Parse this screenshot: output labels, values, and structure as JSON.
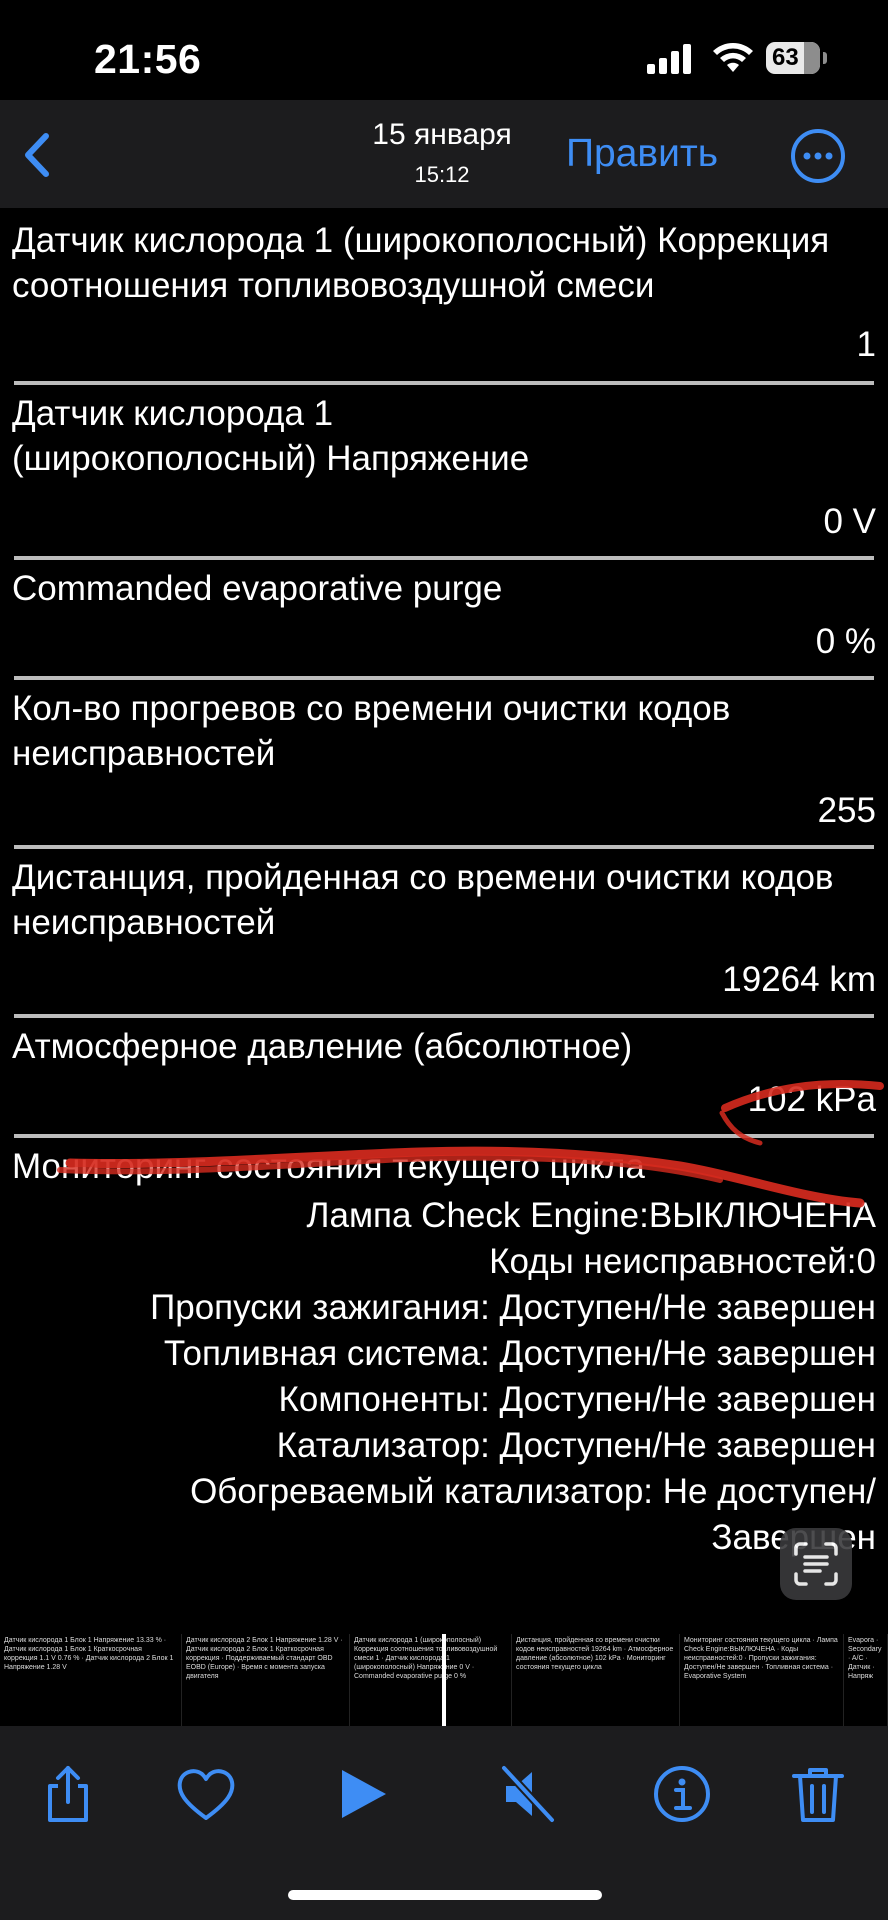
{
  "status_bar": {
    "time": "21:56",
    "battery": "63"
  },
  "nav": {
    "date": "15 января",
    "time": "15:12",
    "edit_label": "Править"
  },
  "rows": [
    {
      "label": "Датчик кислорода 1 (широкополосный) Коррекция соотношения топливовоздушной смеси",
      "value": "1"
    },
    {
      "label": "Датчик кислорода 1 (широкополосный) Напряжение",
      "value": "0 V"
    },
    {
      "label": "Commanded evaporative purge",
      "value": "0 %"
    },
    {
      "label": "Кол-во прогревов со времени очистки кодов неисправностей",
      "value": "255"
    },
    {
      "label": "Дистанция, пройденная со времени очистки кодов неисправностей",
      "value": "19264 km"
    },
    {
      "label": "Атмосферное давление (абсолютное)",
      "value": "102 kPa"
    }
  ],
  "monitor": {
    "title": "Мониторинг состояния текущего цикла",
    "items": [
      "Лампа Check Engine:ВЫКЛЮЧЕНА",
      "Коды неисправностей:0",
      "Пропуски зажигания: Доступен/Не завершен",
      "Топливная система: Доступен/Не завершен",
      "Компоненты: Доступен/Не завершен",
      "Катализатор: Доступен/Не завершен",
      "Обогреваемый катализатор: Не доступен/",
      "Завершен"
    ]
  },
  "thumbnails": [
    {
      "text": "Датчик кислорода 1 Блок 1 Напряжение 13.33 % · Датчик кислорода 1 Блок 1 Краткосрочная коррекция 1.1 V 0.76 % · Датчик кислорода 2 Блок 1 Напряжение 1.28 V"
    },
    {
      "text": "Датчик кислорода 2 Блок 1 Напряжение 1.28 V · Датчик кислорода 2 Блок 1 Краткосрочная коррекция · Поддерживаемый стандарт OBD EOBD (Europe) · Время с момента запуска двигателя"
    },
    {
      "text": "Датчик кислорода 1 (широкополосный) Коррекция соотношения топливовоздушной смеси 1 · Датчик кислорода 1 (широкополосный) Напряжение 0 V · Commanded evaporative purge 0 %"
    },
    {
      "text": "Дистанция, пройденная со времени очистки кодов неисправностей 19264 km · Атмосферное давление (абсолютное) 102 kPa · Мониторинг состояния текущего цикла"
    },
    {
      "text": "Мониторинг состояния текущего цикла · Лампа Check Engine:ВЫКЛЮЧЕНА · Коды неисправностей:0 · Пропуски зажигания: Доступен/Не завершен · Топливная система · Evaporative System"
    },
    {
      "text": "Evapora · Secondary · A/C · Датчик · Напряж"
    }
  ],
  "colors": {
    "accent": "#3e8df4",
    "annotation": "#d62a1e",
    "bar": "#1c1c1e"
  },
  "icons": [
    "chevron-left-icon",
    "more-icon",
    "share-icon",
    "heart-icon",
    "play-icon",
    "mute-icon",
    "info-icon",
    "trash-icon",
    "text-scan-icon"
  ]
}
